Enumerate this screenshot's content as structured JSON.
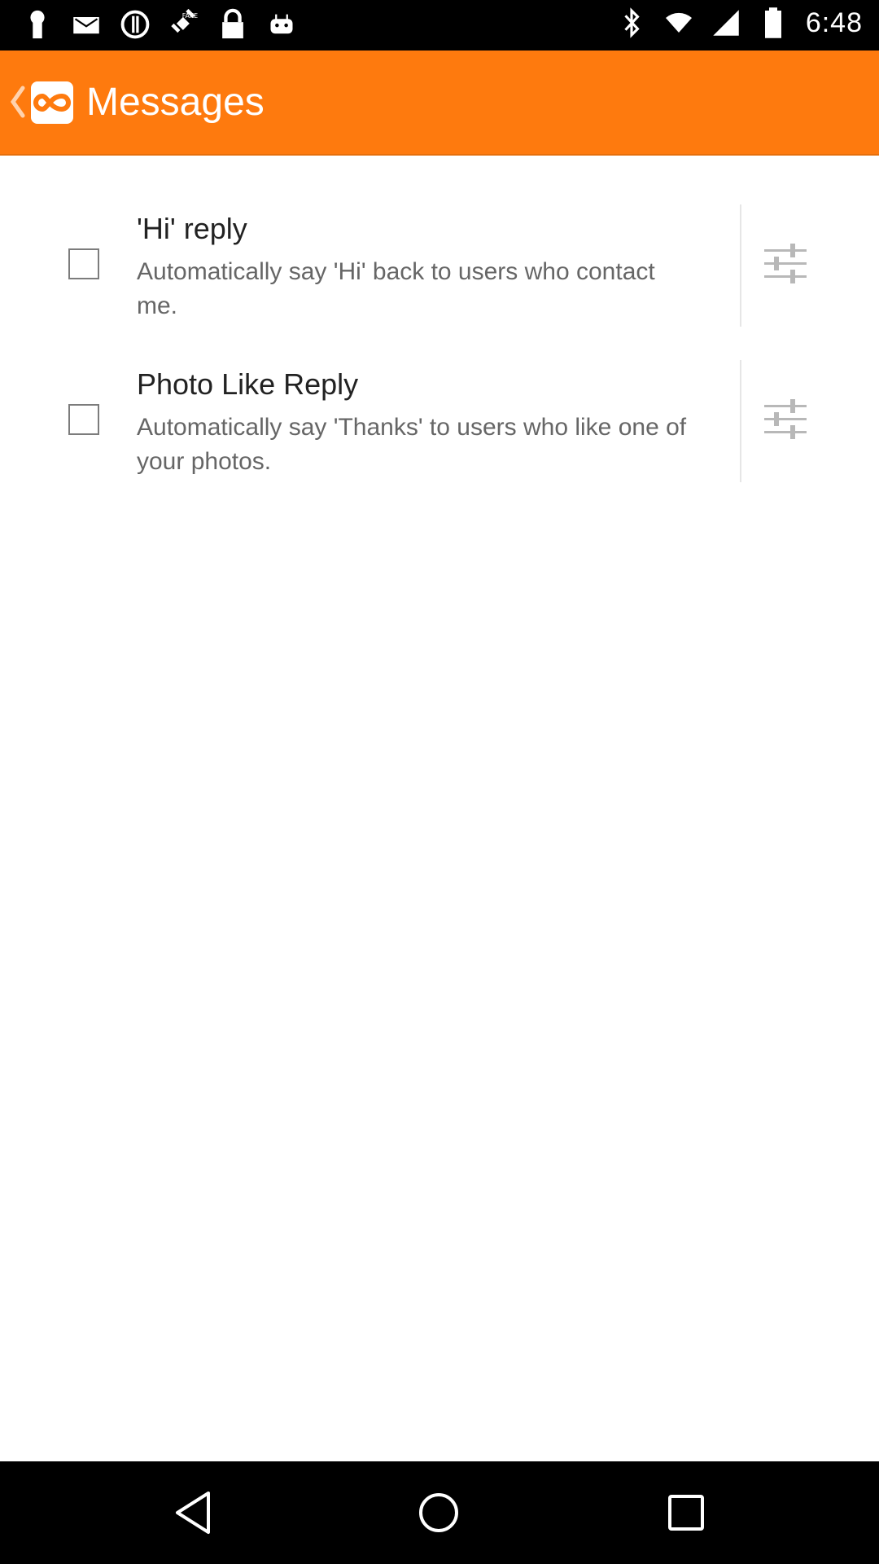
{
  "status_bar": {
    "time": "6:48",
    "left_icons": [
      "keyhole-icon",
      "mail-icon",
      "alert-icon",
      "fake-gps-icon",
      "lock-icon",
      "android-icon"
    ],
    "right_icons": [
      "bluetooth-icon",
      "wifi-icon",
      "signal-icon",
      "battery-icon"
    ]
  },
  "app_bar": {
    "title": "Messages",
    "color": "#fe7a0e"
  },
  "settings": [
    {
      "title": "'Hi' reply",
      "description": "Automatically say 'Hi' back to users who contact me.",
      "checked": false
    },
    {
      "title": "Photo Like Reply",
      "description": "Automatically say 'Thanks' to users who like one of your photos.",
      "checked": false
    }
  ],
  "nav_bar": {
    "buttons": [
      "back",
      "home",
      "recent-apps"
    ]
  }
}
